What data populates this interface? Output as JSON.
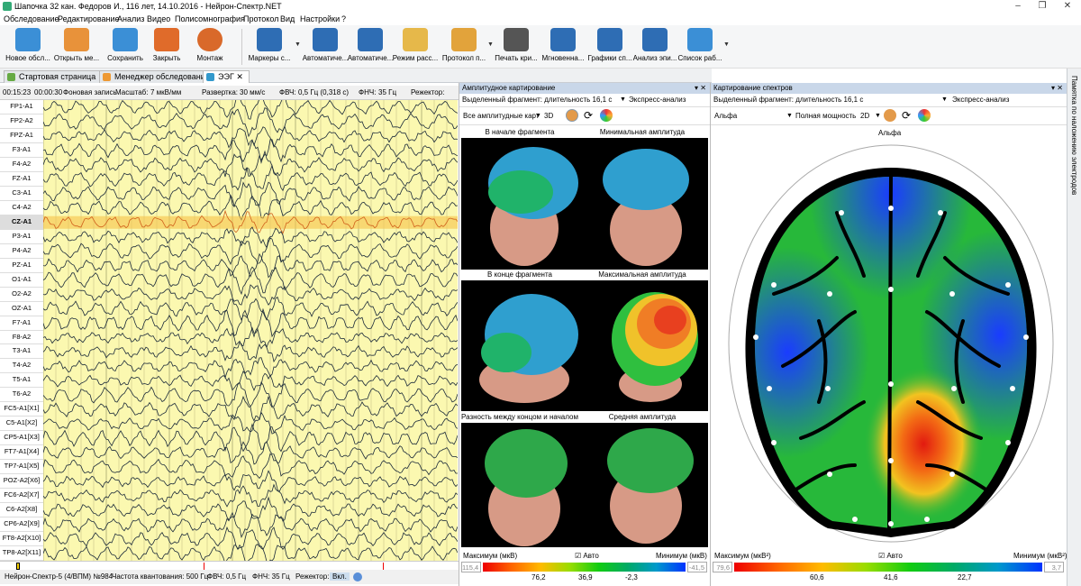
{
  "window": {
    "title": "Шапочка 32 кан. Федоров И., 116 лет, 14.10.2016 - Нейрон-Спектр.NET",
    "minimize": "–",
    "maximize": "❐",
    "close": "✕"
  },
  "menu": [
    "Обследование",
    "Редактирование",
    "Анализ",
    "Видео",
    "Полисомнография",
    "Протокол",
    "Вид",
    "Настройки",
    "?"
  ],
  "toolbar": [
    {
      "label": "Новое обсл...",
      "color": "#3b8fd6"
    },
    {
      "label": "Открыть ме...",
      "color": "#e8923a"
    },
    {
      "label": "Сохранить",
      "color": "#3b8fd6"
    },
    {
      "label": "Закрыть",
      "color": "#e06b2a"
    },
    {
      "label": "Монтаж",
      "color": "#d9692a"
    },
    {
      "label": "Маркеры с...",
      "color": "#2e6db4"
    },
    {
      "label": "Автоматиче...",
      "color": "#2e6db4"
    },
    {
      "label": "Автоматиче...",
      "color": "#2e6db4"
    },
    {
      "label": "Режим расс...",
      "color": "#e6b84a"
    },
    {
      "label": "Протокол п...",
      "color": "#e2a33b"
    },
    {
      "label": "Печать кри...",
      "color": "#555555"
    },
    {
      "label": "Мгновенна...",
      "color": "#2e6db4"
    },
    {
      "label": "Графики сп...",
      "color": "#2e6db4"
    },
    {
      "label": "Анализ эпи...",
      "color": "#2e6db4"
    },
    {
      "label": "Список раб...",
      "color": "#3b8fd6"
    }
  ],
  "tabs": [
    "Стартовая страница",
    "Менеджер обследований",
    "ЭЭГ"
  ],
  "eeg_toolbar": {
    "time": "00:15:23",
    "duration": "00:00:30",
    "mode": "Фоновая запись",
    "scale_label": "Масштаб:",
    "scale": "7 мкВ/мм",
    "sweep_label": "Развертка:",
    "sweep": "30 мм/с",
    "hpf_label": "ФВЧ:",
    "hpf": "0,5 Гц (0,318 с)",
    "lpf_label": "ФНЧ:",
    "lpf": "35 Гц",
    "notch_label": "Режектор:"
  },
  "channels": [
    "FP1-A1",
    "FP2-A2",
    "FPZ-A1",
    "F3-A1",
    "F4-A2",
    "FZ-A1",
    "C3-A1",
    "C4-A2",
    "CZ-A1",
    "P3-A1",
    "P4-A2",
    "PZ-A1",
    "O1-A1",
    "O2-A2",
    "OZ-A1",
    "F7-A1",
    "F8-A2",
    "T3-A1",
    "T4-A2",
    "T5-A1",
    "T6-A2",
    "FC5-A1[X1]",
    "C5-A1[X2]",
    "CP5-A1[X3]",
    "FT7-A1[X4]",
    "TP7-A1[X5]",
    "POZ-A2[X6]",
    "FC6-A2[X7]",
    "C6-A2[X8]",
    "CP6-A2[X9]",
    "FT8-A2[X10]",
    "TP8-A2[X11]"
  ],
  "selected_channel": "CZ-A1",
  "eeg_status": {
    "device": "Нейрон-Спектр-5 (4/ВПМ) №984",
    "sampling": "Частота квантования:  500 Гц",
    "hpf": "ФВЧ:  0,5 Гц",
    "lpf": "ФНЧ:  35 Гц",
    "notch": "Режектор:",
    "on": "Вкл."
  },
  "amp_panel": {
    "title": "Амплитудное картирование",
    "fragment": "Выделенный фрагмент: длительность 16,1 с",
    "express": "Экспресс-анализ",
    "maps_select": "Все амплитудные карт",
    "view_mode": "3D",
    "labels": [
      "В начале фрагмента",
      "Минимальная амплитуда",
      "В конце фрагмента",
      "Максимальная амплитуда",
      "Разность между концом и началом",
      "Средняя амплитуда"
    ],
    "max_label": "Максимум (мкВ)",
    "auto_label": "Авто",
    "min_label": "Минимум (мкВ)",
    "max_value": "115,4",
    "min_value": "-41,5",
    "ticks": [
      "76,2",
      "36,9",
      "-2,3"
    ]
  },
  "spec_panel": {
    "title": "Картирование спектров",
    "fragment": "Выделенный фрагмент: длительность 16,1 с",
    "express": "Экспресс-анализ",
    "band": "Альфа",
    "power": "Полная мощность",
    "view_mode": "2D",
    "map_title": "Альфа",
    "max_label": "Максимум (мкВ²)",
    "auto_label": "Авто",
    "min_label": "Минимум (мкВ²)",
    "max_value": "79,6",
    "min_value": "3,7",
    "ticks": [
      "60,6",
      "41,6",
      "22,7"
    ]
  },
  "sidebar_strip": "Памятка по наложению электродов",
  "colors": {
    "eeg_bg": "#fbf8b0",
    "selected_band": "#f7c34a",
    "header_blue": "#c9d7e9"
  }
}
